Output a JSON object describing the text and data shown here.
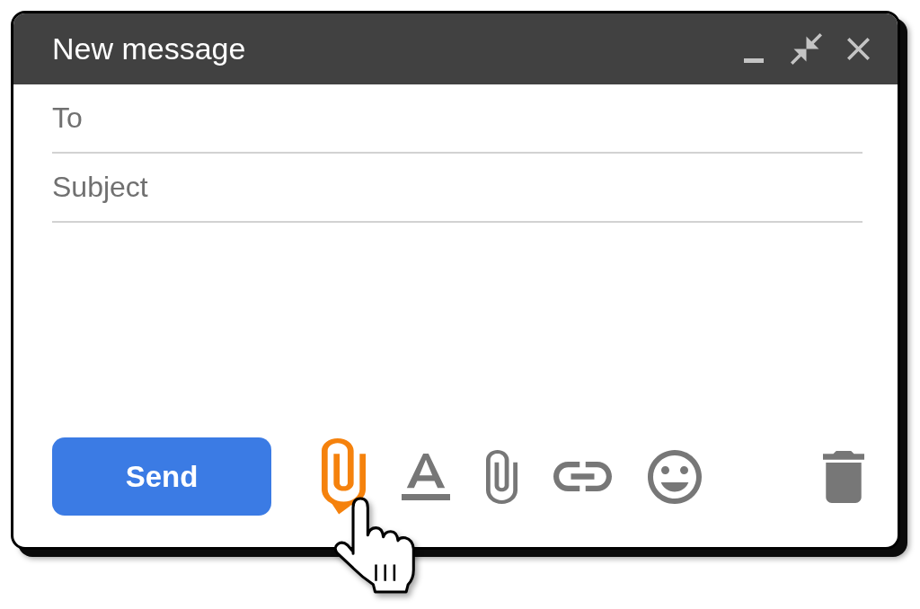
{
  "window": {
    "title": "New message"
  },
  "fields": [
    {
      "placeholder": "To"
    },
    {
      "placeholder": "Subject"
    }
  ],
  "send_button": {
    "label": "Send"
  },
  "toolbar": [
    {
      "kind": "attach",
      "selected": true
    },
    {
      "kind": "format",
      "selected": false
    },
    {
      "kind": "attach",
      "selected": false
    },
    {
      "kind": "link",
      "selected": false
    },
    {
      "kind": "emoji",
      "selected": false
    }
  ]
}
